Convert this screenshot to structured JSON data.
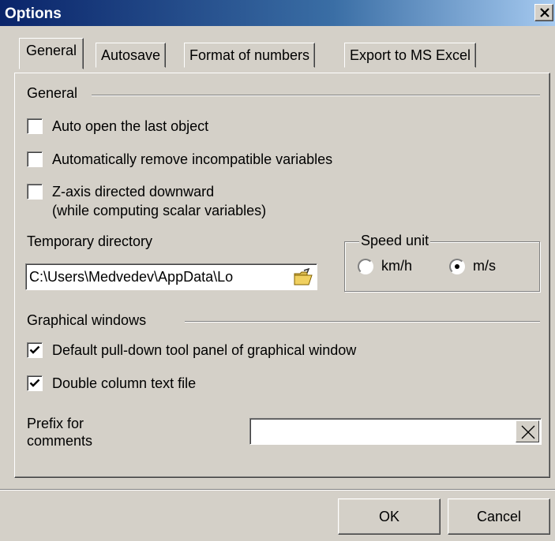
{
  "window": {
    "title": "Options"
  },
  "tabs": [
    {
      "label": "General"
    },
    {
      "label": "Autosave"
    },
    {
      "label": "Format of numbers"
    },
    {
      "label": "Export to MS Excel"
    }
  ],
  "general_group": {
    "title": "General",
    "auto_open": {
      "label": "Auto open the last object",
      "checked": false
    },
    "auto_remove": {
      "label": "Automatically remove incompatible variables",
      "checked": false
    },
    "z_axis": {
      "label": "Z-axis directed downward",
      "sublabel": "(while computing scalar variables)",
      "checked": false
    }
  },
  "temp_dir": {
    "label": "Temporary directory",
    "value": "C:\\Users\\Medvedev\\AppData\\Lo"
  },
  "speed_unit": {
    "title": "Speed unit",
    "options": [
      "km/h",
      "m/s"
    ],
    "selected": "m/s"
  },
  "graphical_group": {
    "title": "Graphical windows",
    "pulldown": {
      "label": "Default pull-down tool panel of graphical window",
      "checked": true
    },
    "double_column": {
      "label": "Double column text file",
      "checked": true
    }
  },
  "prefix": {
    "label_line1": "Prefix for",
    "label_line2": "comments",
    "value": ""
  },
  "buttons": {
    "ok": "OK",
    "cancel": "Cancel"
  }
}
